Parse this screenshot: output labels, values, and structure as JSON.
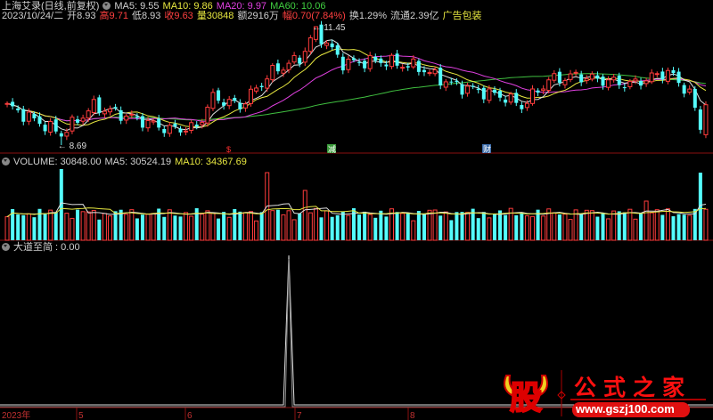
{
  "header": {
    "stock_title": "上海艾录(日线,前复权)",
    "ma5": "MA5: 9.55",
    "ma10": "MA10: 9.86",
    "ma20": "MA20: 9.97",
    "ma60": "MA60: 10.06",
    "date": "2023/10/24/二",
    "open": "开8.93",
    "high": "高9.71",
    "low": "低8.93",
    "close": "收9.63",
    "vol": "量30848",
    "amount": "额2916万",
    "change": "幅0.70(7.84%)",
    "turnover": "换1.29%",
    "float": "流通2.39亿",
    "ad": "广告包装"
  },
  "main": {
    "max_label": "11.45",
    "min_label": "8.69",
    "markers": [
      "$",
      "减",
      "财"
    ]
  },
  "volume": {
    "label": "VOLUME: 30848.00",
    "ma5": "MA5: 30524.19",
    "ma10": "MA10: 34367.69"
  },
  "indicator": {
    "label": "大道至简 : 0.00"
  },
  "axis": {
    "labels": [
      "2023年",
      "5",
      "6",
      "7",
      "8"
    ]
  },
  "logo": {
    "char": "股",
    "name": "公式之家",
    "url": "www.gszj100.com"
  },
  "colors": {
    "up": "#ff3c3c",
    "down": "#54fcfc",
    "ma5": "#e0e0e0",
    "ma10": "#e8e840",
    "ma20": "#e040e0",
    "ma60": "#40c040",
    "frame": "#8a1010"
  },
  "chart_data": {
    "type": "candlestick",
    "count": 130,
    "anchor_closes": [
      [
        0,
        9.6
      ],
      [
        10,
        8.95
      ],
      [
        16,
        9.6
      ],
      [
        30,
        9.05
      ],
      [
        35,
        9.1
      ],
      [
        38,
        9.8
      ],
      [
        43,
        9.6
      ],
      [
        49,
        10.4
      ],
      [
        54,
        10.7
      ],
      [
        57,
        11.35
      ],
      [
        62,
        10.6
      ],
      [
        69,
        10.65
      ],
      [
        76,
        10.5
      ],
      [
        82,
        10.1
      ],
      [
        92,
        9.8
      ],
      [
        95,
        9.6
      ],
      [
        100,
        10.2
      ],
      [
        105,
        10.3
      ],
      [
        115,
        10.1
      ],
      [
        122,
        10.4
      ],
      [
        126,
        9.9
      ],
      [
        128,
        9.1
      ],
      [
        129,
        9.63
      ]
    ],
    "volume_spikes": [
      [
        10,
        1.0
      ],
      [
        35,
        0.45
      ],
      [
        48,
        0.95
      ],
      [
        55,
        0.7
      ],
      [
        118,
        0.55
      ],
      [
        128,
        0.95
      ]
    ],
    "indicator_spike_index": 52
  }
}
